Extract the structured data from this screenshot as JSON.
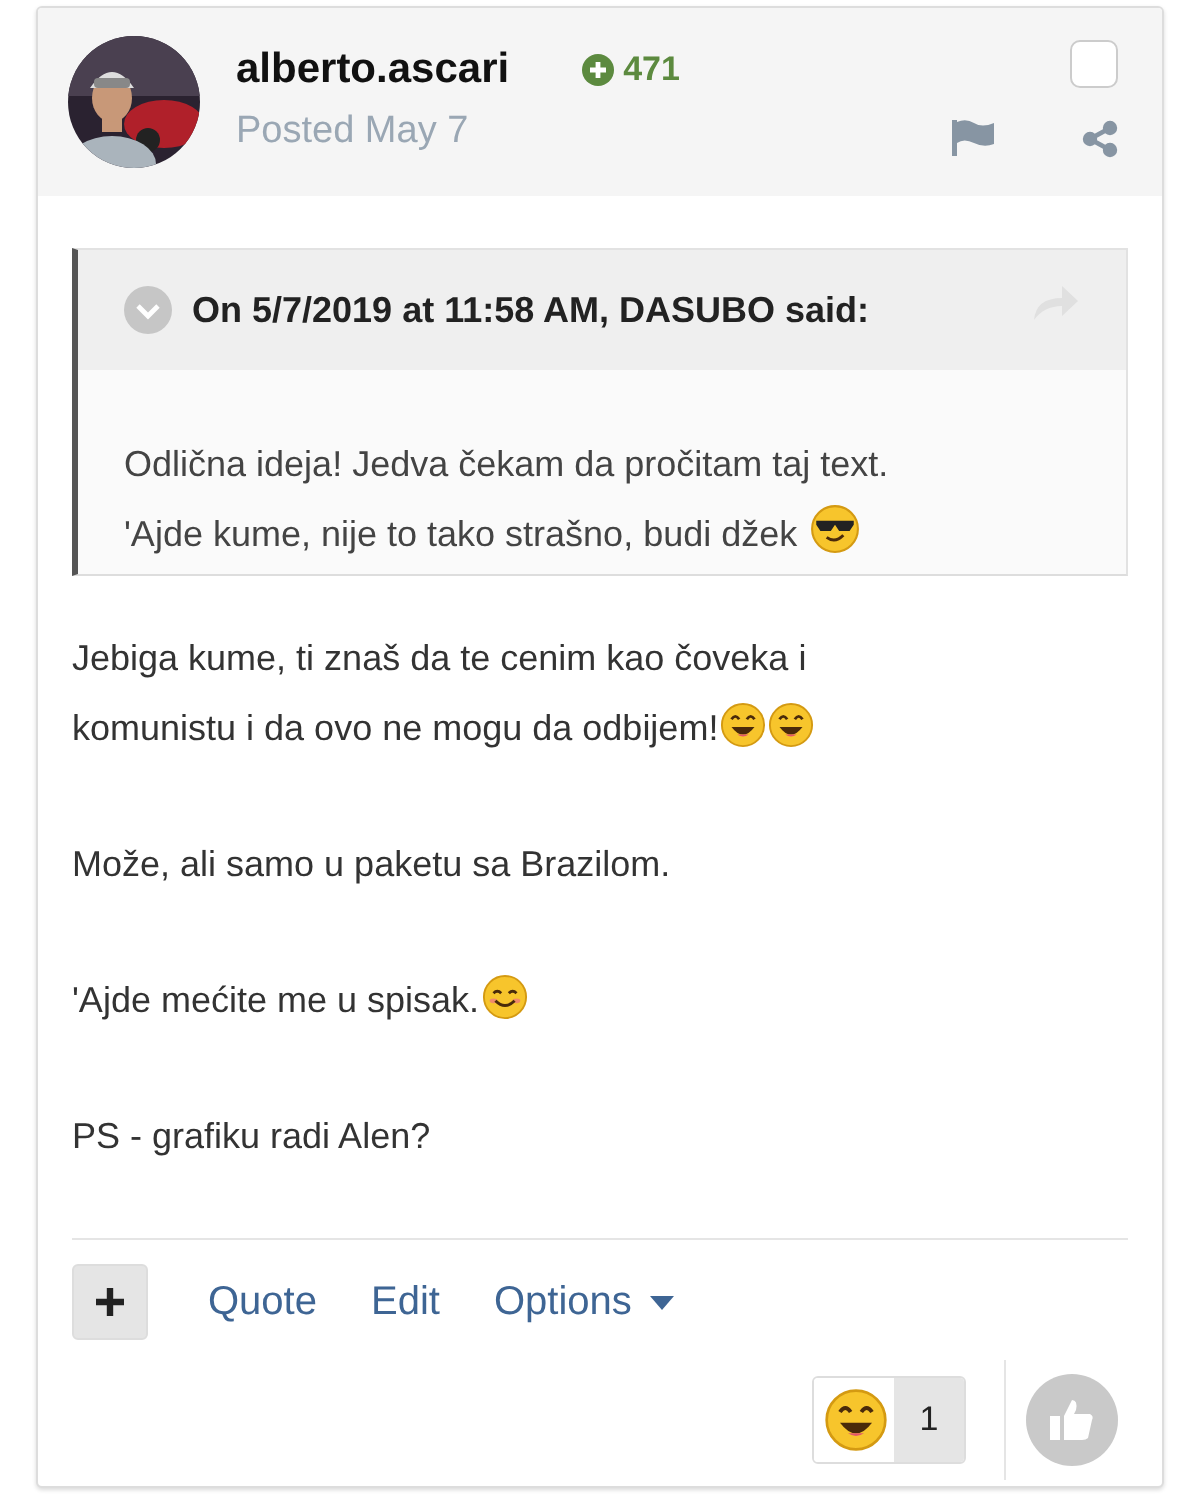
{
  "post": {
    "author": "alberto.ascari",
    "reputation": "471",
    "posted": "Posted May 7",
    "selected": false,
    "avatar": {
      "kind": "picture"
    },
    "quote": {
      "citation": "On 5/7/2019 at 11:58 AM, DASUBO said:",
      "lines": [
        "Odlična ideja! Jedva čekam da pročitam taj text.",
        "'Ajde kume, nije to tako strašno, budi džek"
      ]
    },
    "paragraphs": [
      [
        "Jebiga kume, ti znaš da te cenim kao čoveka i",
        "komunistu i da ovo ne mogu da odbijem!"
      ],
      [
        "Može, ali samo u paketu sa Brazilom."
      ],
      [
        "'Ajde mećite me u spisak."
      ],
      [
        "PS - grafiku radi Alen?"
      ]
    ],
    "actions": [
      "Quote",
      "Edit",
      "Options"
    ],
    "reactions": [
      {
        "count": "1"
      }
    ]
  }
}
